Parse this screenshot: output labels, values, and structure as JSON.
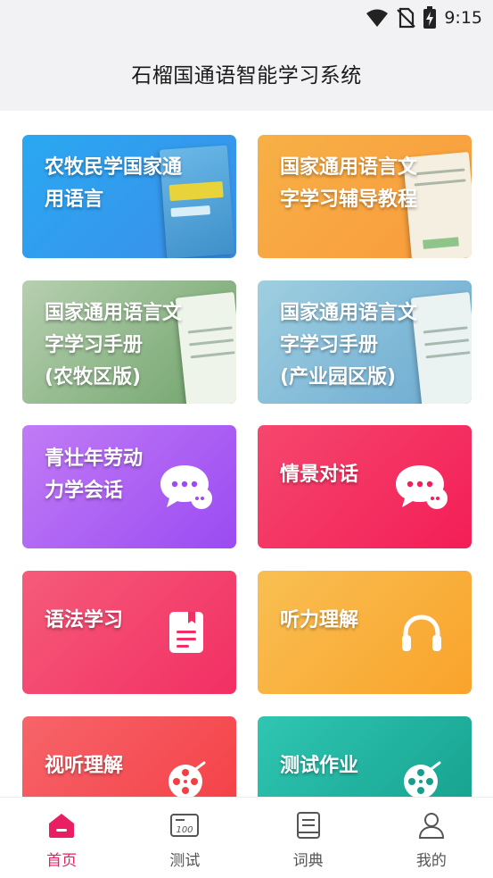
{
  "status": {
    "time": "9:15",
    "icons": [
      "wifi-icon",
      "no-sim-icon",
      "battery-charging-icon"
    ]
  },
  "header": {
    "title": "石榴国通语智能学习系统"
  },
  "cards": [
    {
      "label": "农牧民学国家通\n用语言",
      "gradient": [
        "#2aa8f2",
        "#3b8ee8"
      ]
    },
    {
      "label": "国家通用语言文\n字学习辅导教程",
      "gradient": [
        "#f7b046",
        "#f99a3c"
      ]
    },
    {
      "label": "国家通用语言文\n字学习手册\n(农牧区版)",
      "gradient": [
        "#b6cfb0",
        "#6fa36a"
      ]
    },
    {
      "label": "国家通用语言文\n字学习手册\n(产业园区版)",
      "gradient": [
        "#9fcfe0",
        "#6aa9d1"
      ]
    },
    {
      "label": "青壮年劳动\n力学会话",
      "gradient": [
        "#c17bf5",
        "#9b4bf2"
      ],
      "icon": "chat-bubbles-icon"
    },
    {
      "label": "情景对话",
      "gradient": [
        "#f5476e",
        "#f31e57"
      ],
      "icon": "chat-bubbles-icon"
    },
    {
      "label": "语法学习",
      "gradient": [
        "#f55b7a",
        "#f22f63"
      ],
      "icon": "bookmark-book-icon"
    },
    {
      "label": "听力理解",
      "gradient": [
        "#f9bf52",
        "#f9a32b"
      ],
      "icon": "headphones-icon"
    },
    {
      "label": "视听理解",
      "gradient": [
        "#f6646a",
        "#f43e44"
      ],
      "icon": "film-reel-icon"
    },
    {
      "label": "测试作业",
      "gradient": [
        "#2fc6b2",
        "#149f8c"
      ],
      "icon": "film-reel-icon"
    }
  ],
  "tabs": [
    {
      "label": "首页",
      "icon": "home-icon",
      "active": true
    },
    {
      "label": "测试",
      "icon": "test-score-icon",
      "active": false
    },
    {
      "label": "词典",
      "icon": "dictionary-icon",
      "active": false
    },
    {
      "label": "我的",
      "icon": "profile-icon",
      "active": false
    }
  ],
  "colors": {
    "accent": "#e91e63",
    "tab_inactive": "#555555"
  }
}
